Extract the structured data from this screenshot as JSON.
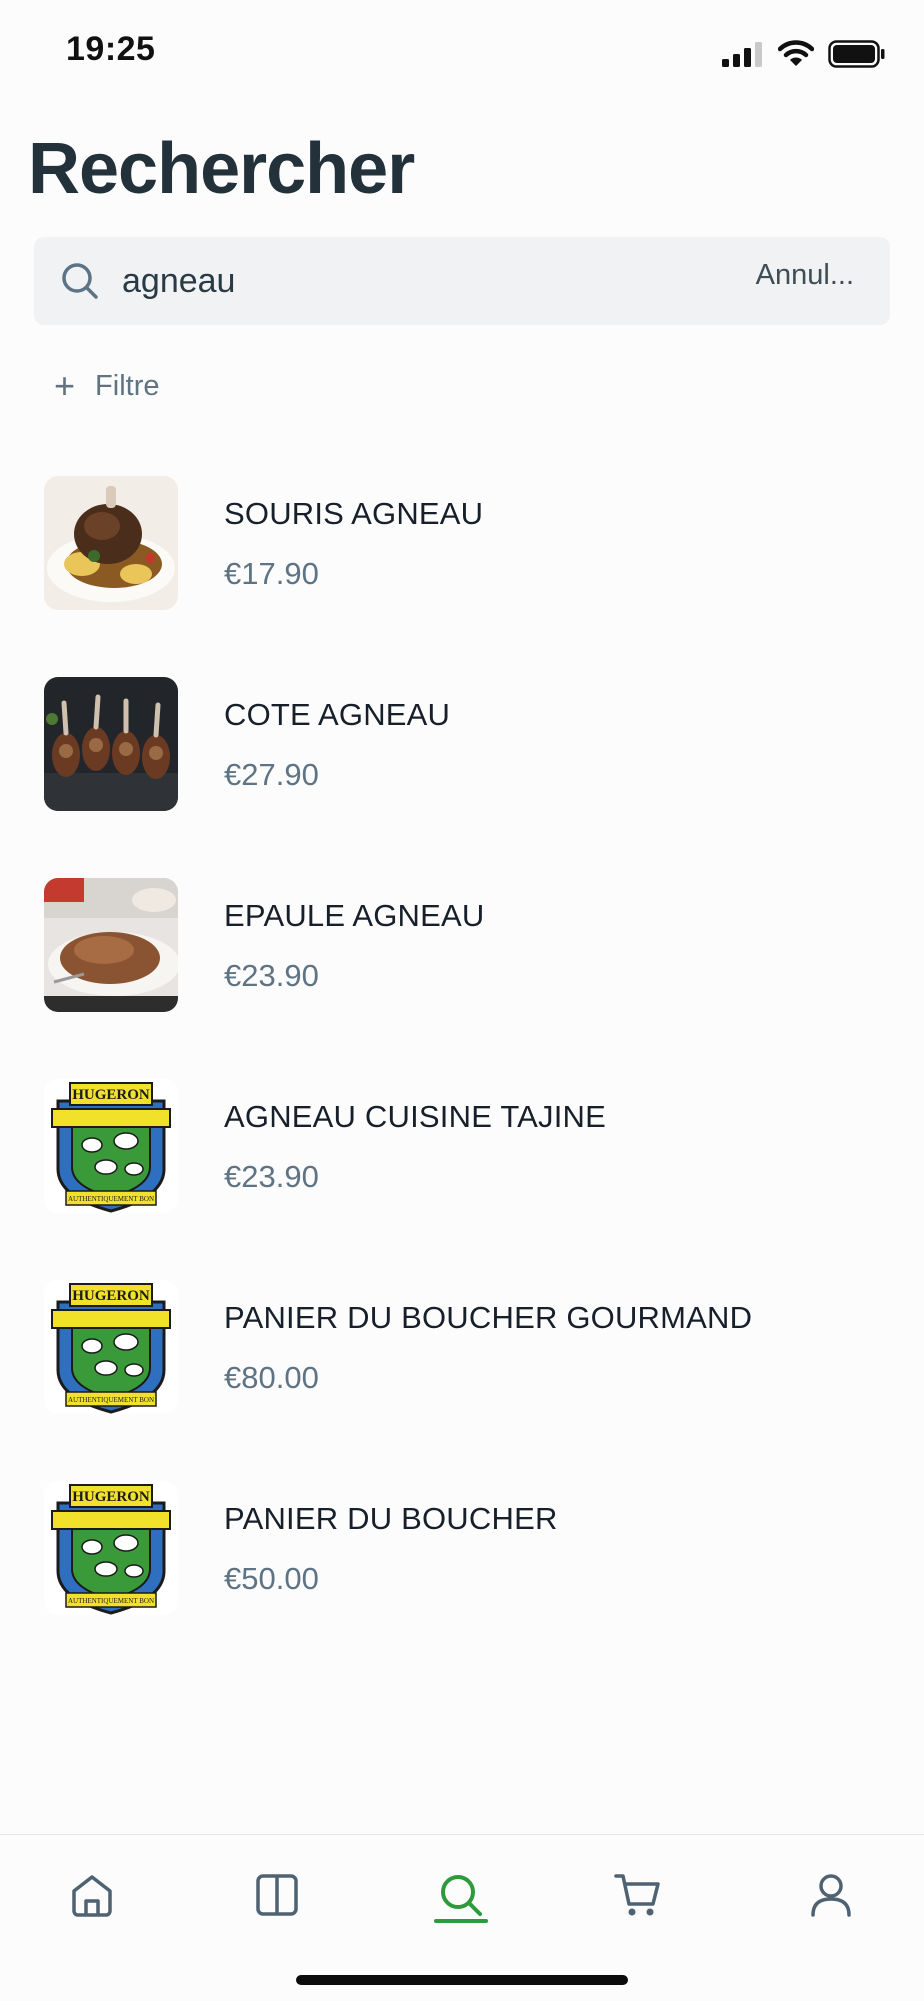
{
  "status_bar": {
    "time": "19:25"
  },
  "page": {
    "title": "Rechercher"
  },
  "search": {
    "value": "agneau",
    "cancel_label": "Annul..."
  },
  "filter": {
    "plus": "+",
    "label": "Filtre"
  },
  "results": [
    {
      "name": "SOURIS AGNEAU",
      "price": "€17.90",
      "image": "braised-lamb-shank-photo"
    },
    {
      "name": "COTE AGNEAU",
      "price": "€27.90",
      "image": "grilled-lamb-chops-photo"
    },
    {
      "name": "EPAULE AGNEAU",
      "price": "€23.90",
      "image": "roast-lamb-shoulder-photo"
    },
    {
      "name": "AGNEAU CUISINE TAJINE",
      "price": "€23.90",
      "image": "hugeron-logo"
    },
    {
      "name": "PANIER DU BOUCHER GOURMAND",
      "price": "€80.00",
      "image": "hugeron-logo"
    },
    {
      "name": "PANIER DU BOUCHER",
      "price": "€50.00",
      "image": "hugeron-logo"
    }
  ],
  "logo_text": {
    "top": "HUGERON",
    "banner": "AUTHENTIQUEMENT BON"
  },
  "tab_bar": {
    "tabs": [
      "home-icon",
      "catalog-icon",
      "search-icon",
      "cart-icon",
      "profile-icon"
    ],
    "active_tab": "search-icon",
    "active_color": "#2e9b3a"
  }
}
